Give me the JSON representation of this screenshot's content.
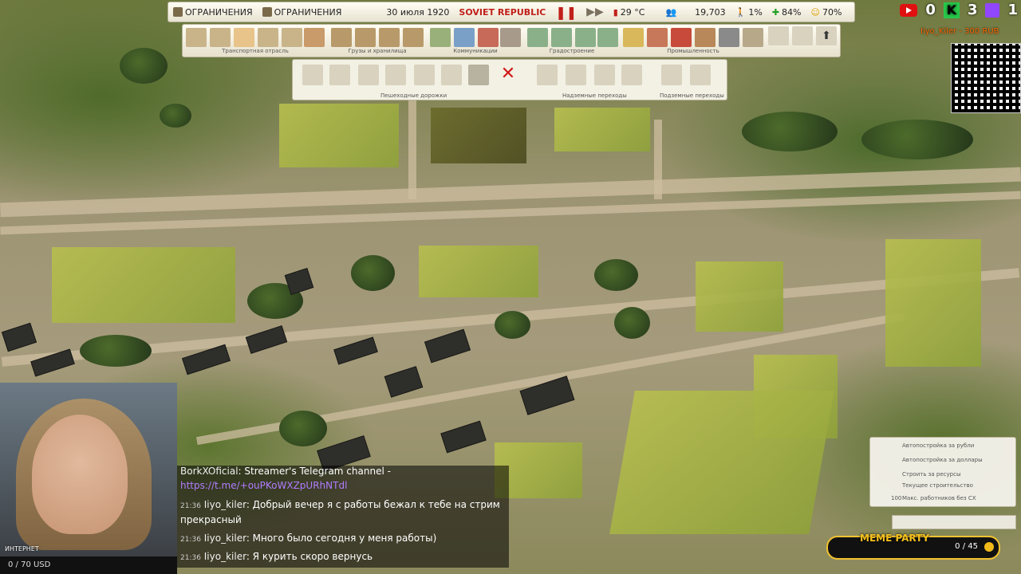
{
  "topbar": {
    "restriction_1": "ОГРАНИЧЕНИЯ",
    "restriction_2": "ОГРАНИЧЕНИЯ",
    "date": "30 июля 1920",
    "game_title": "SOVIET REPUBLIC",
    "temperature": "29 °C",
    "population": "19,703",
    "stat_1": "1%",
    "stat_2": "84%",
    "stat_3": "70%"
  },
  "toolbar": {
    "groups": [
      {
        "label": "Транспортная отрасль"
      },
      {
        "label": "Грузы и хранилища"
      },
      {
        "label": "Коммуникации"
      },
      {
        "label": "Градостроение"
      },
      {
        "label": "Промышленность"
      }
    ]
  },
  "submenu": {
    "labels": [
      "Пешеходные дорожки",
      "Надземные переходы",
      "Подземные переходы"
    ]
  },
  "social": {
    "youtube": "0",
    "kick": "3",
    "twitch": "1"
  },
  "donor": "Iiyo_Kiler - 300 RUB",
  "webcam": {
    "label": "ИНТЕРНЕТ"
  },
  "counter": "0 / 70 USD",
  "chat": {
    "lines": [
      {
        "time": "",
        "user": "BorkXOficial",
        "text": ": Streamer's Telegram channel -"
      },
      {
        "time": "",
        "user": "",
        "text": "https://t.me/+ouPKoWXZpURhNTdl"
      },
      {
        "time": "21:36",
        "user": "Iiyo_kiler",
        "text": ": Добрый вечер я с работы бежал к тебе на стрим"
      },
      {
        "time": "",
        "user": "",
        "text": "прекрасный"
      },
      {
        "time": "21:36",
        "user": "Iiyo_kiler",
        "text": ": Много было сегодня у меня работы)"
      },
      {
        "time": "21:36",
        "user": "Iiyo_kiler",
        "text": ": Я курить скоро вернусь"
      }
    ]
  },
  "right_panel": {
    "items": [
      "Автопостройка за рубли",
      "Автопостройка за доллары",
      "Строить за ресурсы",
      "Текущее строительство",
      "Макс. работников без СХ"
    ],
    "max_workers": "100"
  },
  "meme_party": {
    "title": "MEME PARTY",
    "count": "0 / 45"
  }
}
